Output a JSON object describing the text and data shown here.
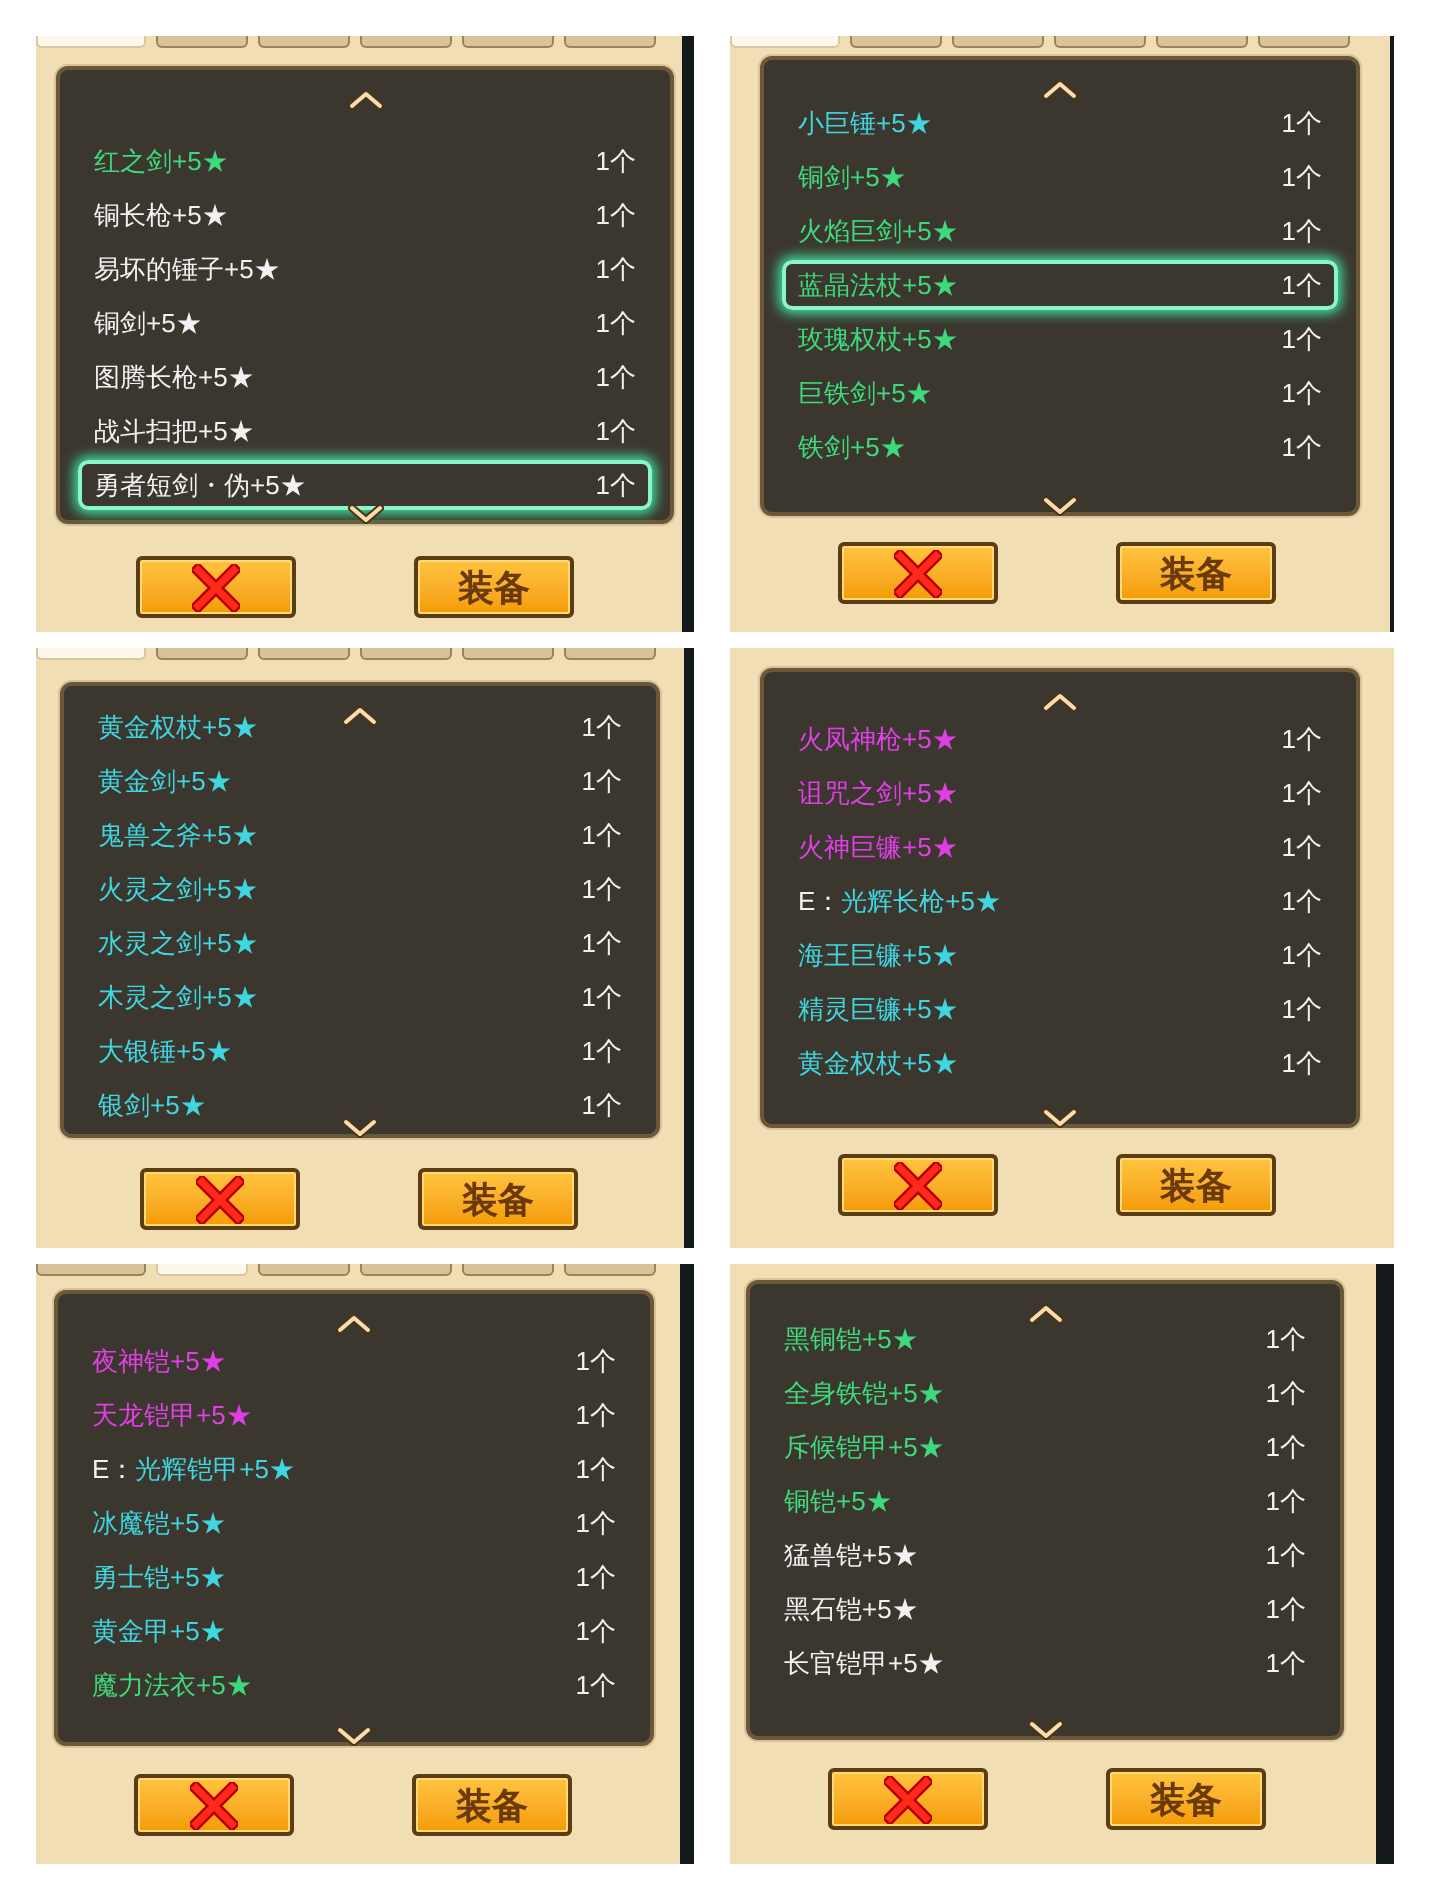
{
  "rows": [
    {
      "left": {
        "tabs": [
          {
            "selected": true
          },
          {
            "selected": false
          },
          {
            "selected": false
          },
          {
            "selected": false
          },
          {
            "selected": false
          },
          {
            "selected": false
          }
        ],
        "items": [
          {
            "name": "红之剑+5★",
            "color": "#3ed97c",
            "count": "1个",
            "selected": false
          },
          {
            "name": "铜长枪+5★",
            "color": "#f2f2f2",
            "count": "1个",
            "selected": false
          },
          {
            "name": "易坏的锤子+5★",
            "color": "#f2f2f2",
            "count": "1个",
            "selected": false
          },
          {
            "name": "铜剑+5★",
            "color": "#f2f2f2",
            "count": "1个",
            "selected": false
          },
          {
            "name": "图腾长枪+5★",
            "color": "#f2f2f2",
            "count": "1个",
            "selected": false
          },
          {
            "name": "战斗扫把+5★",
            "color": "#f2f2f2",
            "count": "1个",
            "selected": false
          },
          {
            "name": "勇者短剑・伪+5★",
            "color": "#f2f2f2",
            "count": "1个",
            "selected": true
          }
        ],
        "equip_button": {
          "label": "装备"
        }
      },
      "right": {
        "tabs": [
          {
            "selected": true
          },
          {
            "selected": false
          },
          {
            "selected": false
          },
          {
            "selected": false
          },
          {
            "selected": false
          },
          {
            "selected": false
          }
        ],
        "items": [
          {
            "name": "小巨锤+5★",
            "color": "#3fd6e0",
            "count": "1个",
            "selected": false
          },
          {
            "name": "铜剑+5★",
            "color": "#3ed97c",
            "count": "1个",
            "selected": false
          },
          {
            "name": "火焰巨剑+5★",
            "color": "#3ed97c",
            "count": "1个",
            "selected": false
          },
          {
            "name": "蓝晶法杖+5★",
            "color": "#3ed97c",
            "count": "1个",
            "selected": true
          },
          {
            "name": "玫瑰权杖+5★",
            "color": "#3ed97c",
            "count": "1个",
            "selected": false
          },
          {
            "name": "巨铁剑+5★",
            "color": "#3ed97c",
            "count": "1个",
            "selected": false
          },
          {
            "name": "铁剑+5★",
            "color": "#3ed97c",
            "count": "1个",
            "selected": false
          }
        ],
        "equip_button": {
          "label": "装备"
        }
      }
    },
    {
      "left": {
        "tabs": [
          {
            "selected": true
          },
          {
            "selected": false
          },
          {
            "selected": false
          },
          {
            "selected": false
          },
          {
            "selected": false
          },
          {
            "selected": false
          }
        ],
        "items": [
          {
            "name": "黄金权杖+5★",
            "color": "#3fd6e0",
            "count": "1个",
            "selected": false
          },
          {
            "name": "黄金剑+5★",
            "color": "#3fd6e0",
            "count": "1个",
            "selected": false
          },
          {
            "name": "鬼兽之斧+5★",
            "color": "#3fd6e0",
            "count": "1个",
            "selected": false
          },
          {
            "name": "火灵之剑+5★",
            "color": "#3fd6e0",
            "count": "1个",
            "selected": false
          },
          {
            "name": "水灵之剑+5★",
            "color": "#3fd6e0",
            "count": "1个",
            "selected": false
          },
          {
            "name": "木灵之剑+5★",
            "color": "#3fd6e0",
            "count": "1个",
            "selected": false
          },
          {
            "name": "大银锤+5★",
            "color": "#3fd6e0",
            "count": "1个",
            "selected": false
          },
          {
            "name": "银剑+5★",
            "color": "#3fd6e0",
            "count": "1个",
            "selected": false
          }
        ],
        "equip_button": {
          "label": "装备"
        }
      },
      "right": {
        "items": [
          {
            "name": "火凤神枪+5★",
            "color": "#e03fe6",
            "count": "1个",
            "selected": false
          },
          {
            "name": "诅咒之剑+5★",
            "color": "#e03fe6",
            "count": "1个",
            "selected": false
          },
          {
            "name": "火神巨镰+5★",
            "color": "#e03fe6",
            "count": "1个",
            "selected": false
          },
          {
            "prefix": "E：",
            "name": "光辉长枪+5★",
            "color": "#3fd6e0",
            "count": "1个",
            "selected": false
          },
          {
            "name": "海王巨镰+5★",
            "color": "#3fd6e0",
            "count": "1个",
            "selected": false
          },
          {
            "name": "精灵巨镰+5★",
            "color": "#3fd6e0",
            "count": "1个",
            "selected": false
          },
          {
            "name": "黄金权杖+5★",
            "color": "#3fd6e0",
            "count": "1个",
            "selected": false
          }
        ],
        "equip_button": {
          "label": "装备"
        }
      }
    },
    {
      "left": {
        "tabs": [
          {
            "selected": false
          },
          {
            "selected": true
          },
          {
            "selected": false
          },
          {
            "selected": false
          },
          {
            "selected": false
          },
          {
            "selected": false
          }
        ],
        "items": [
          {
            "name": "夜神铠+5★",
            "color": "#e03fe6",
            "count": "1个",
            "selected": false
          },
          {
            "name": "天龙铠甲+5★",
            "color": "#e03fe6",
            "count": "1个",
            "selected": false
          },
          {
            "prefix": "E：",
            "name": "光辉铠甲+5★",
            "color": "#3fd6e0",
            "count": "1个",
            "selected": false
          },
          {
            "name": "冰魔铠+5★",
            "color": "#3fd6e0",
            "count": "1个",
            "selected": false
          },
          {
            "name": "勇士铠+5★",
            "color": "#3fd6e0",
            "count": "1个",
            "selected": false
          },
          {
            "name": "黄金甲+5★",
            "color": "#3fd6e0",
            "count": "1个",
            "selected": false
          },
          {
            "name": "魔力法衣+5★",
            "color": "#3ed97c",
            "count": "1个",
            "selected": false
          }
        ],
        "equip_button": {
          "label": "装备"
        }
      },
      "right": {
        "items": [
          {
            "name": "黑铜铠+5★",
            "color": "#3ed97c",
            "count": "1个",
            "selected": false
          },
          {
            "name": "全身铁铠+5★",
            "color": "#3ed97c",
            "count": "1个",
            "selected": false
          },
          {
            "name": "斥候铠甲+5★",
            "color": "#3ed97c",
            "count": "1个",
            "selected": false
          },
          {
            "name": "铜铠+5★",
            "color": "#3ed97c",
            "count": "1个",
            "selected": false
          },
          {
            "name": "猛兽铠+5★",
            "color": "#f2f2f2",
            "count": "1个",
            "selected": false
          },
          {
            "name": "黑石铠+5★",
            "color": "#f2f2f2",
            "count": "1个",
            "selected": false
          },
          {
            "name": "长官铠甲+5★",
            "color": "#f2f2f2",
            "count": "1个",
            "selected": false
          }
        ],
        "equip_button": {
          "label": "装备"
        }
      }
    }
  ]
}
